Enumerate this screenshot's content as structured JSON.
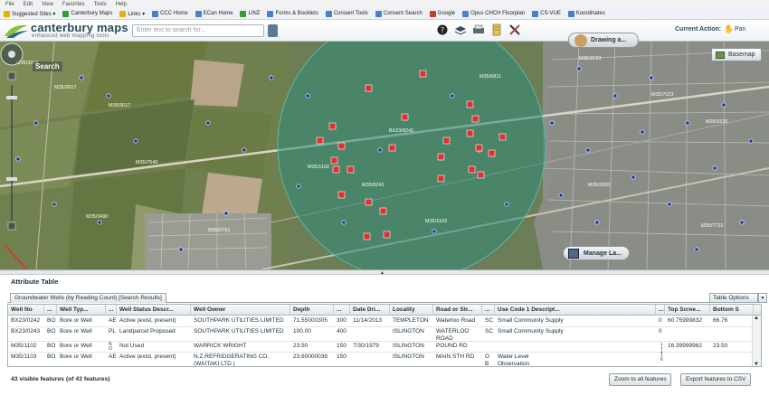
{
  "browser": {
    "menu": [
      "File",
      "Edit",
      "View",
      "Favorites",
      "Tools",
      "Help"
    ],
    "bookmarks": [
      {
        "label": "Suggested Sites ▾",
        "icon": "star-icon"
      },
      {
        "label": "Canterbury Maps",
        "icon": "page-icon"
      },
      {
        "label": "Links ▾",
        "icon": "folder-icon"
      },
      {
        "label": "CCC Home",
        "icon": "page-icon"
      },
      {
        "label": "ECan Home",
        "icon": "page-icon"
      },
      {
        "label": "LINZ",
        "icon": "page-icon"
      },
      {
        "label": "Forms & Booklets",
        "icon": "page-icon"
      },
      {
        "label": "Consent Tools",
        "icon": "page-icon"
      },
      {
        "label": "Consent Search",
        "icon": "page-icon"
      },
      {
        "label": "Google",
        "icon": "page-icon"
      },
      {
        "label": "Opus CHCH Floorplan",
        "icon": "page-icon"
      },
      {
        "label": "CS-VUE",
        "icon": "page-icon"
      },
      {
        "label": "Koordinates",
        "icon": "page-icon"
      }
    ]
  },
  "app": {
    "title": "canterbury maps",
    "subtitle": "enhanced web mapping tools",
    "search_placeholder": "Enter text to search for...",
    "current_action_label": "Current Action:",
    "current_action_value": "Pan",
    "toolbar_icons": [
      "help-icon",
      "layers-icon",
      "print-icon",
      "edit-icon",
      "tools-icon"
    ]
  },
  "map": {
    "search_label": "Search",
    "drawing_label": "Drawing a...",
    "basemap_label": "Basemap",
    "manage_label": "Manage La...",
    "well_labels": [
      "M35/3262",
      "M35/2617",
      "M35/3017",
      "M35/7540",
      "M35/1102",
      "M35/0243",
      "M35/3163",
      "M35/7023",
      "M35/1520",
      "M35/2650",
      "BX23/0242",
      "M35/1103",
      "M35/3490",
      "M35/0751",
      "M35/7722",
      "M35/6811"
    ]
  },
  "attribute_table": {
    "title": "Attribute Table",
    "layer_tab": "Groundwater Wells (by Reading Count) [Search Results]",
    "options_label": "Table Options",
    "columns": [
      "Well No",
      "...",
      "Well Typ...",
      "...",
      "Well Status Descr...",
      "Well Owner",
      "Depth",
      "...",
      "Date Dri...",
      "Locality",
      "Road or Str...",
      "...",
      "Use Code 1 Descript...",
      "...",
      "Top Scree...",
      "Bottom S"
    ],
    "rows": [
      [
        "BX23/0242",
        "BO",
        "Bore or Well",
        "AE",
        "Active (exist, present)",
        "SOUTHPARK UTILITIES LIMITED",
        "71.55000305",
        "300",
        "11/14/2013",
        "TEMPLETON",
        "Waterloo Road",
        "SC",
        "Small Community Supply",
        "0",
        "60.75999832",
        "66.76"
      ],
      [
        "BX23/0243",
        "BO",
        "Bore or Well",
        "PL",
        "Landparcel Proposed",
        "SOUTHPARK UTILITIES LIMITED",
        "100.00",
        "400",
        "",
        "ISLINGTON",
        "WATERLOO ROAD",
        "SC",
        "Small Community Supply",
        "0",
        "",
        ""
      ],
      [
        "M35/1102",
        "BO",
        "Bore or Well",
        "N O",
        "Not Used",
        "WARRICK WRIGHT",
        "23.50",
        "150",
        "7/30/1979",
        "ISLINGTON",
        "POUND RD",
        "",
        "",
        "1 1 1",
        "16.39999962",
        "23.50"
      ],
      [
        "M35/1103",
        "BO",
        "Bore or Well",
        "AE",
        "Active (exist, present)",
        "N.Z.REFRIDGERATING CO. (WAITAKI LTD.)",
        "23.60000038",
        "150",
        "",
        "ISLINGTON",
        "MAIN STH RD",
        "O B",
        "Water Level Observation",
        "1 6",
        "",
        ""
      ]
    ],
    "status": "43 visible features (of 43 features)",
    "zoom_button": "Zoom to all features",
    "export_button": "Export features to CSV"
  },
  "colors": {
    "buffer_fill": "#2e8a7a",
    "well_marker": "#e03030",
    "header_text": "#2c4a5a"
  }
}
